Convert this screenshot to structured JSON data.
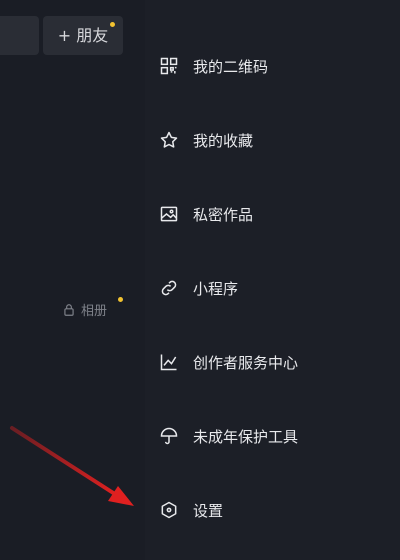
{
  "header": {
    "add_friend_label": "+ 朋友"
  },
  "profile": {
    "album_label": "相册"
  },
  "menu": {
    "items": [
      {
        "label": "我的二维码",
        "icon": "qr-code-icon"
      },
      {
        "label": "我的收藏",
        "icon": "star-icon"
      },
      {
        "label": "私密作品",
        "icon": "private-image-icon"
      },
      {
        "label": "小程序",
        "icon": "link-icon"
      },
      {
        "label": "创作者服务中心",
        "icon": "chart-icon"
      },
      {
        "label": "未成年保护工具",
        "icon": "umbrella-icon"
      },
      {
        "label": "设置",
        "icon": "settings-hex-icon"
      }
    ]
  },
  "colors": {
    "accent_dot": "#f2c230",
    "annotation_arrow": "#e02020",
    "background": "#181b23"
  }
}
